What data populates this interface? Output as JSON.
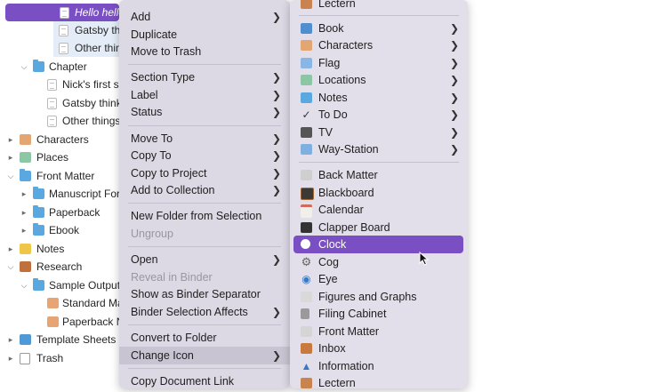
{
  "binder": {
    "rows": [
      {
        "label": "Hello hello",
        "icon": "document-icon",
        "state": "selected"
      },
      {
        "label": "Gatsby thi",
        "icon": "document-icon",
        "state": "light"
      },
      {
        "label": "Other thin",
        "icon": "document-icon",
        "state": "light"
      },
      {
        "label": "Chapter",
        "icon": "folder-icon",
        "state": ""
      },
      {
        "label": "Nick's first sc",
        "icon": "document-icon",
        "state": ""
      },
      {
        "label": "Gatsby thinks",
        "icon": "document-icon",
        "state": ""
      },
      {
        "label": "Other things",
        "icon": "document-icon",
        "state": ""
      },
      {
        "label": "Characters",
        "icon": "characters-icon",
        "state": ""
      },
      {
        "label": "Places",
        "icon": "places-icon",
        "state": ""
      },
      {
        "label": "Front Matter",
        "icon": "folder-icon",
        "state": ""
      },
      {
        "label": "Manuscript Form",
        "icon": "folder-icon",
        "state": ""
      },
      {
        "label": "Paperback",
        "icon": "folder-icon",
        "state": ""
      },
      {
        "label": "Ebook",
        "icon": "folder-icon",
        "state": ""
      },
      {
        "label": "Notes",
        "icon": "notes-icon",
        "state": ""
      },
      {
        "label": "Research",
        "icon": "research-icon",
        "state": ""
      },
      {
        "label": "Sample Output",
        "icon": "folder-icon",
        "state": ""
      },
      {
        "label": "Standard Ma",
        "icon": "document-icon",
        "state": ""
      },
      {
        "label": "Paperback N",
        "icon": "document-icon",
        "state": ""
      },
      {
        "label": "Template Sheets",
        "icon": "template-icon",
        "state": ""
      },
      {
        "label": "Trash",
        "icon": "trash-icon",
        "state": ""
      }
    ]
  },
  "context_menu": {
    "items": [
      {
        "label": "Add",
        "submenu": true
      },
      {
        "label": "Duplicate"
      },
      {
        "label": "Move to Trash"
      },
      {
        "label": "Section Type",
        "submenu": true
      },
      {
        "label": "Label",
        "submenu": true
      },
      {
        "label": "Status",
        "submenu": true
      },
      {
        "label": "Move To",
        "submenu": true
      },
      {
        "label": "Copy To",
        "submenu": true
      },
      {
        "label": "Copy to Project",
        "submenu": true
      },
      {
        "label": "Add to Collection",
        "submenu": true
      },
      {
        "label": "New Folder from Selection"
      },
      {
        "label": "Ungroup",
        "disabled": true
      },
      {
        "label": "Open",
        "submenu": true
      },
      {
        "label": "Reveal in Binder",
        "disabled": true
      },
      {
        "label": "Show as Binder Separator"
      },
      {
        "label": "Binder Selection Affects",
        "submenu": true
      },
      {
        "label": "Convert to Folder"
      },
      {
        "label": "Change Icon",
        "submenu": true,
        "highlighted": true
      },
      {
        "label": "Copy Document Link"
      }
    ]
  },
  "icon_menu": {
    "items": [
      {
        "label": "Lectern",
        "icon": "lectern-icon"
      },
      {
        "label": "Book",
        "icon": "book-icon",
        "submenu": true
      },
      {
        "label": "Characters",
        "icon": "characters-icon",
        "submenu": true
      },
      {
        "label": "Flag",
        "icon": "flag-icon",
        "submenu": true
      },
      {
        "label": "Locations",
        "icon": "locations-icon",
        "submenu": true
      },
      {
        "label": "Notes",
        "icon": "notes-icon",
        "submenu": true
      },
      {
        "label": "To Do",
        "icon": "checkmark-icon",
        "submenu": true
      },
      {
        "label": "TV",
        "icon": "tv-icon",
        "submenu": true
      },
      {
        "label": "Way-Station",
        "icon": "way-station-icon",
        "submenu": true
      },
      {
        "label": "Back Matter",
        "icon": "back-matter-icon"
      },
      {
        "label": "Blackboard",
        "icon": "blackboard-icon"
      },
      {
        "label": "Calendar",
        "icon": "calendar-icon"
      },
      {
        "label": "Clapper Board",
        "icon": "clapper-board-icon"
      },
      {
        "label": "Clock",
        "icon": "clock-icon",
        "highlighted": true
      },
      {
        "label": "Cog",
        "icon": "cog-icon"
      },
      {
        "label": "Eye",
        "icon": "eye-icon"
      },
      {
        "label": "Figures and Graphs",
        "icon": "figures-graphs-icon"
      },
      {
        "label": "Filing Cabinet",
        "icon": "filing-cabinet-icon"
      },
      {
        "label": "Front Matter",
        "icon": "front-matter-icon"
      },
      {
        "label": "Inbox",
        "icon": "inbox-icon"
      },
      {
        "label": "Information",
        "icon": "information-icon"
      },
      {
        "label": "Lectern",
        "icon": "lectern-icon"
      }
    ]
  },
  "colors": {
    "selection": "#7a4fc4",
    "menu_bg": "#dcd8e4",
    "folder": "#5aa8e0"
  }
}
